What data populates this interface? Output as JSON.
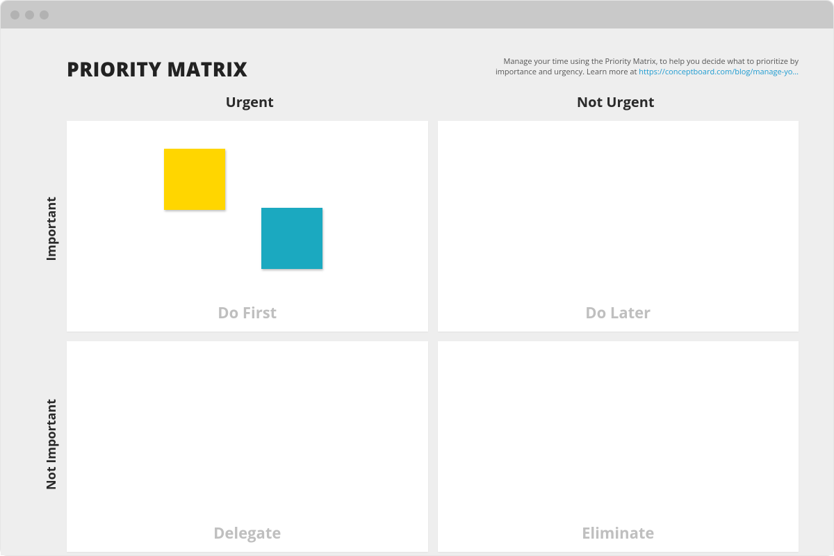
{
  "title": "PRIORITY MATRIX",
  "description_text": "Manage your time using the Priority Matrix, to help you decide what to prioritize by importance and urgency. Learn more at ",
  "description_link": "https://conceptboard.com/blog/manage-yo...",
  "columns": {
    "urgent": "Urgent",
    "not_urgent": "Not Urgent"
  },
  "rows": {
    "important": "Important",
    "not_important": "Not Important"
  },
  "quadrants": {
    "q1": "Do First",
    "q2": "Do Later",
    "q3": "Delegate",
    "q4": "Eliminate"
  },
  "stickies": {
    "yellow": {
      "color": "#ffd600"
    },
    "teal": {
      "color": "#1ba9c0"
    }
  }
}
